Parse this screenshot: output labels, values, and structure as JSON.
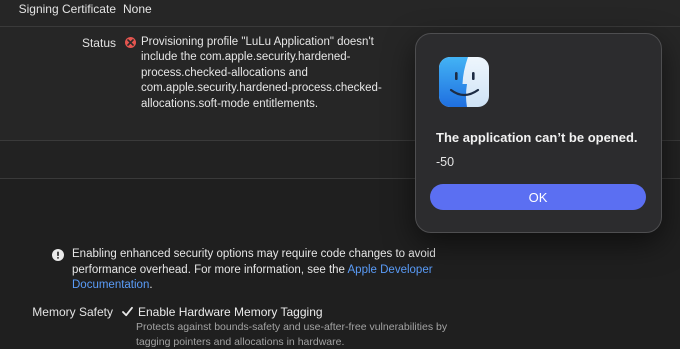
{
  "signing": {
    "label": "Signing Certificate",
    "value": "None"
  },
  "status": {
    "label": "Status",
    "message": "Provisioning profile \"LuLu Application\" doesn't include the com.apple.security.hardened-process.checked-allocations and com.apple.security.hardened-process.checked-allocations.soft-mode entitlements."
  },
  "info": {
    "text": "Enabling enhanced security options may require code changes to avoid performance overhead. For more information, see the ",
    "link_text": "Apple Developer Documentation",
    "suffix": "."
  },
  "memory_safety": {
    "label": "Memory Safety",
    "checkbox_label": "Enable Hardware Memory Tagging",
    "checked": true,
    "description": "Protects against bounds-safety and use-after-free vulnerabilities by tagging pointers and allocations in hardware."
  },
  "alert": {
    "title": "The application can’t be opened.",
    "message": "-50",
    "ok_label": "OK"
  },
  "icons": {
    "error": "error-x-icon",
    "info": "info-exclamation-icon",
    "checkmark": "checkmark-icon",
    "app": "finder-icon"
  },
  "colors": {
    "accent": "#5b6ff2",
    "error": "#e5554f",
    "link": "#5a9cf8"
  }
}
